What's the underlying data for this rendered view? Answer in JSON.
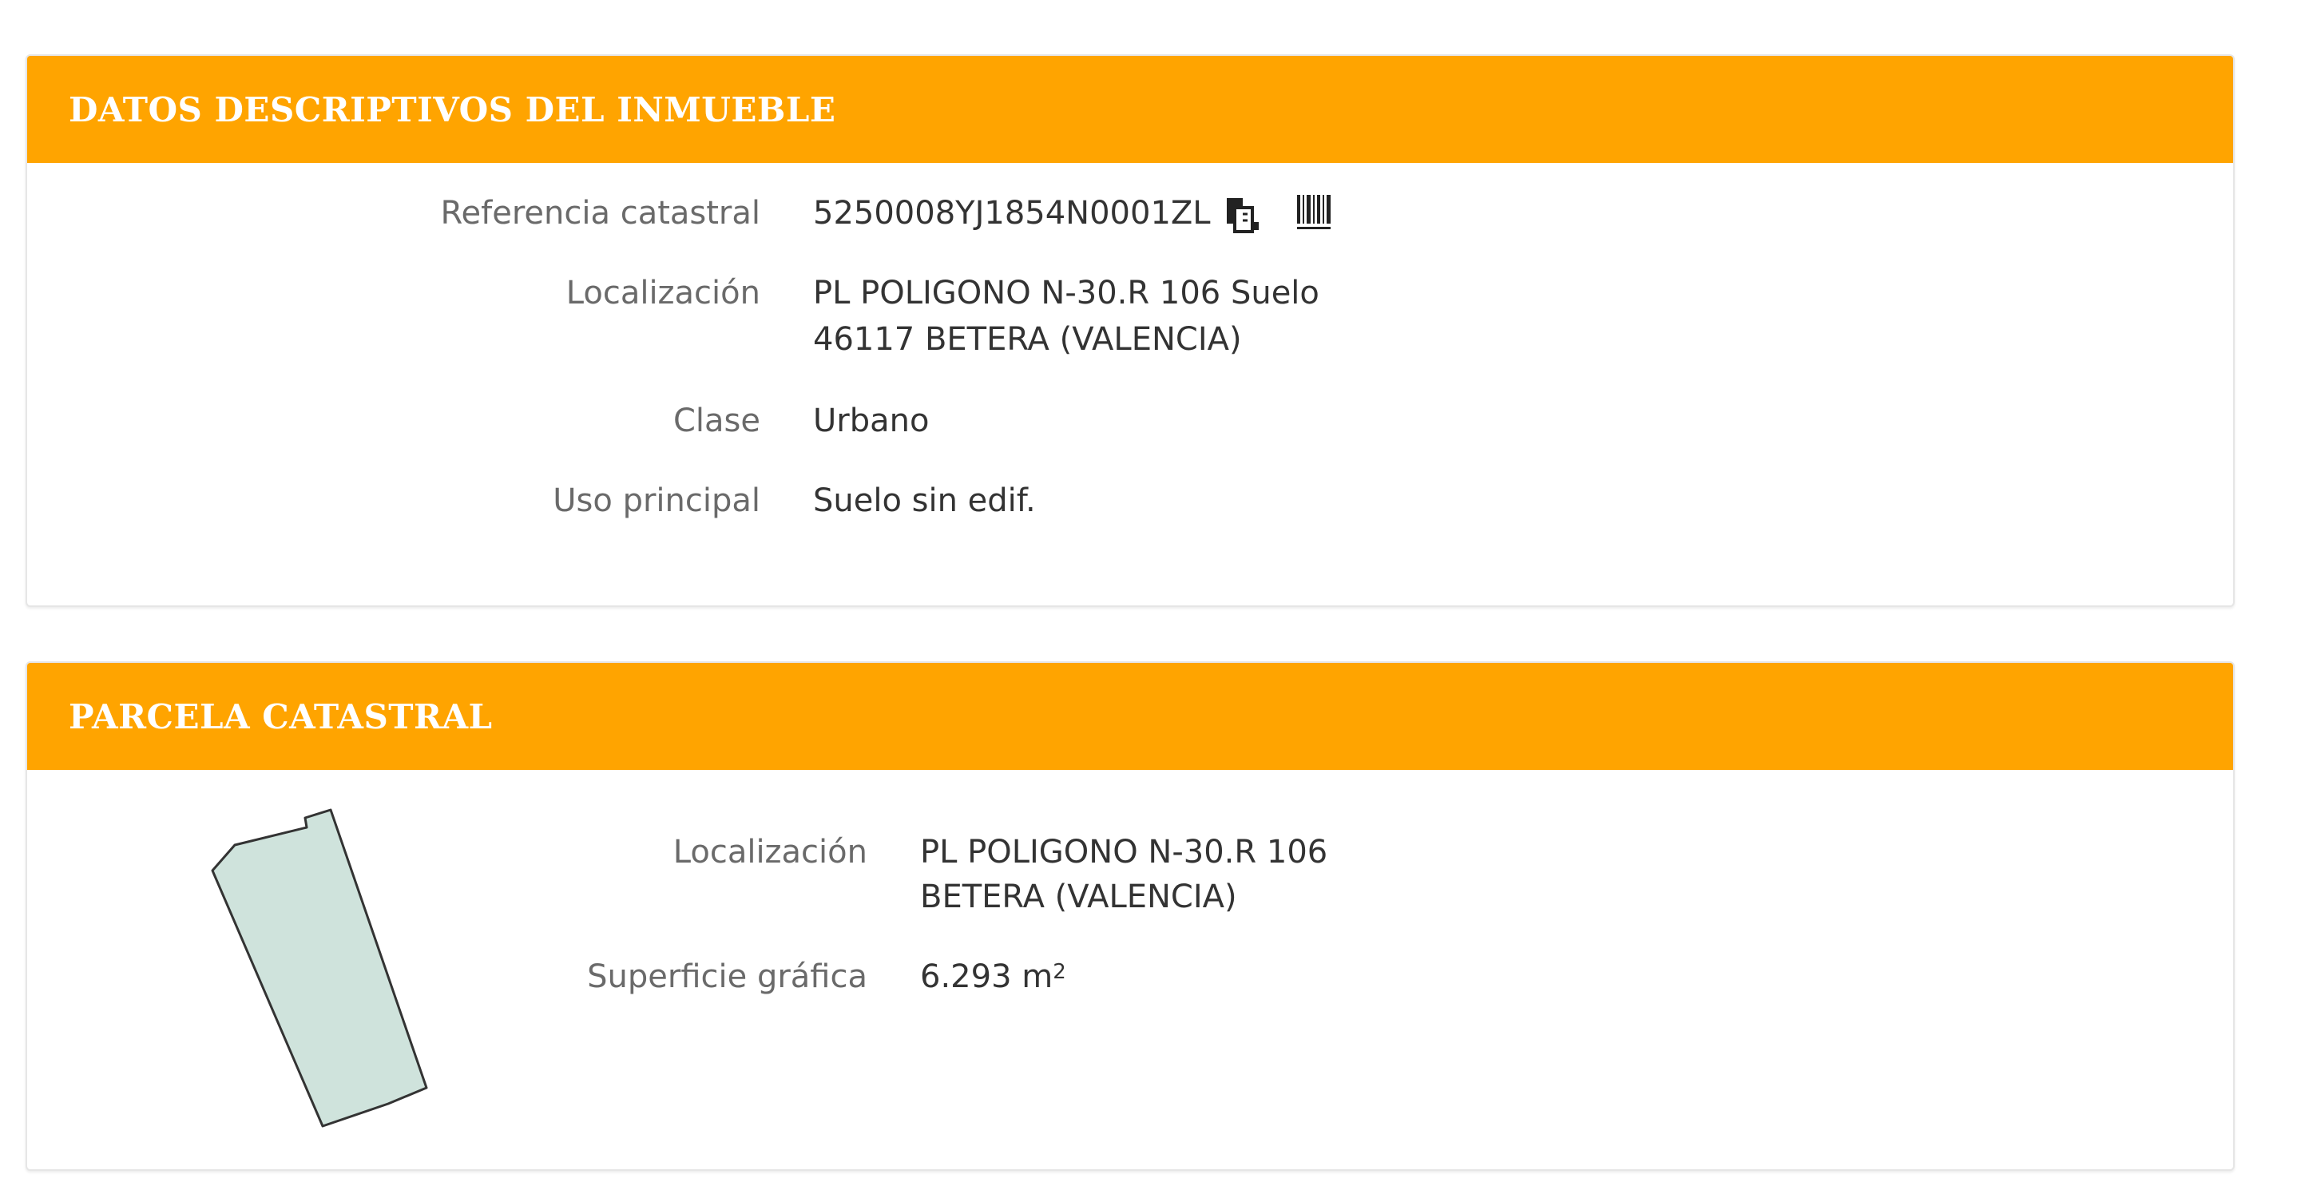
{
  "colors": {
    "header_bg": "#ffa400",
    "header_text": "#ffffff",
    "label_text": "#6a6a6a",
    "value_text": "#333333",
    "parcel_fill": "#cfe3dc",
    "parcel_stroke": "#333333"
  },
  "inmueble": {
    "title": "DATOS DESCRIPTIVOS DEL INMUEBLE",
    "referencia_label": "Referencia catastral",
    "referencia_value": "5250008YJ1854N0001ZL",
    "copy_icon": "copy-icon",
    "barcode_icon": "barcode-icon",
    "localizacion_label": "Localización",
    "localizacion_line1": "PL POLIGONO N-30.R 106 Suelo",
    "localizacion_line2": "46117 BETERA (VALENCIA)",
    "clase_label": "Clase",
    "clase_value": "Urbano",
    "uso_label": "Uso principal",
    "uso_value": "Suelo sin edif."
  },
  "parcela": {
    "title": "PARCELA CATASTRAL",
    "localizacion_label": "Localización",
    "localizacion_line1": "PL POLIGONO N-30.R 106",
    "localizacion_line2": "BETERA (VALENCIA)",
    "superficie_label": "Superficie gráfica",
    "superficie_value": "6.293 m",
    "superficie_unit_exp": "2"
  }
}
